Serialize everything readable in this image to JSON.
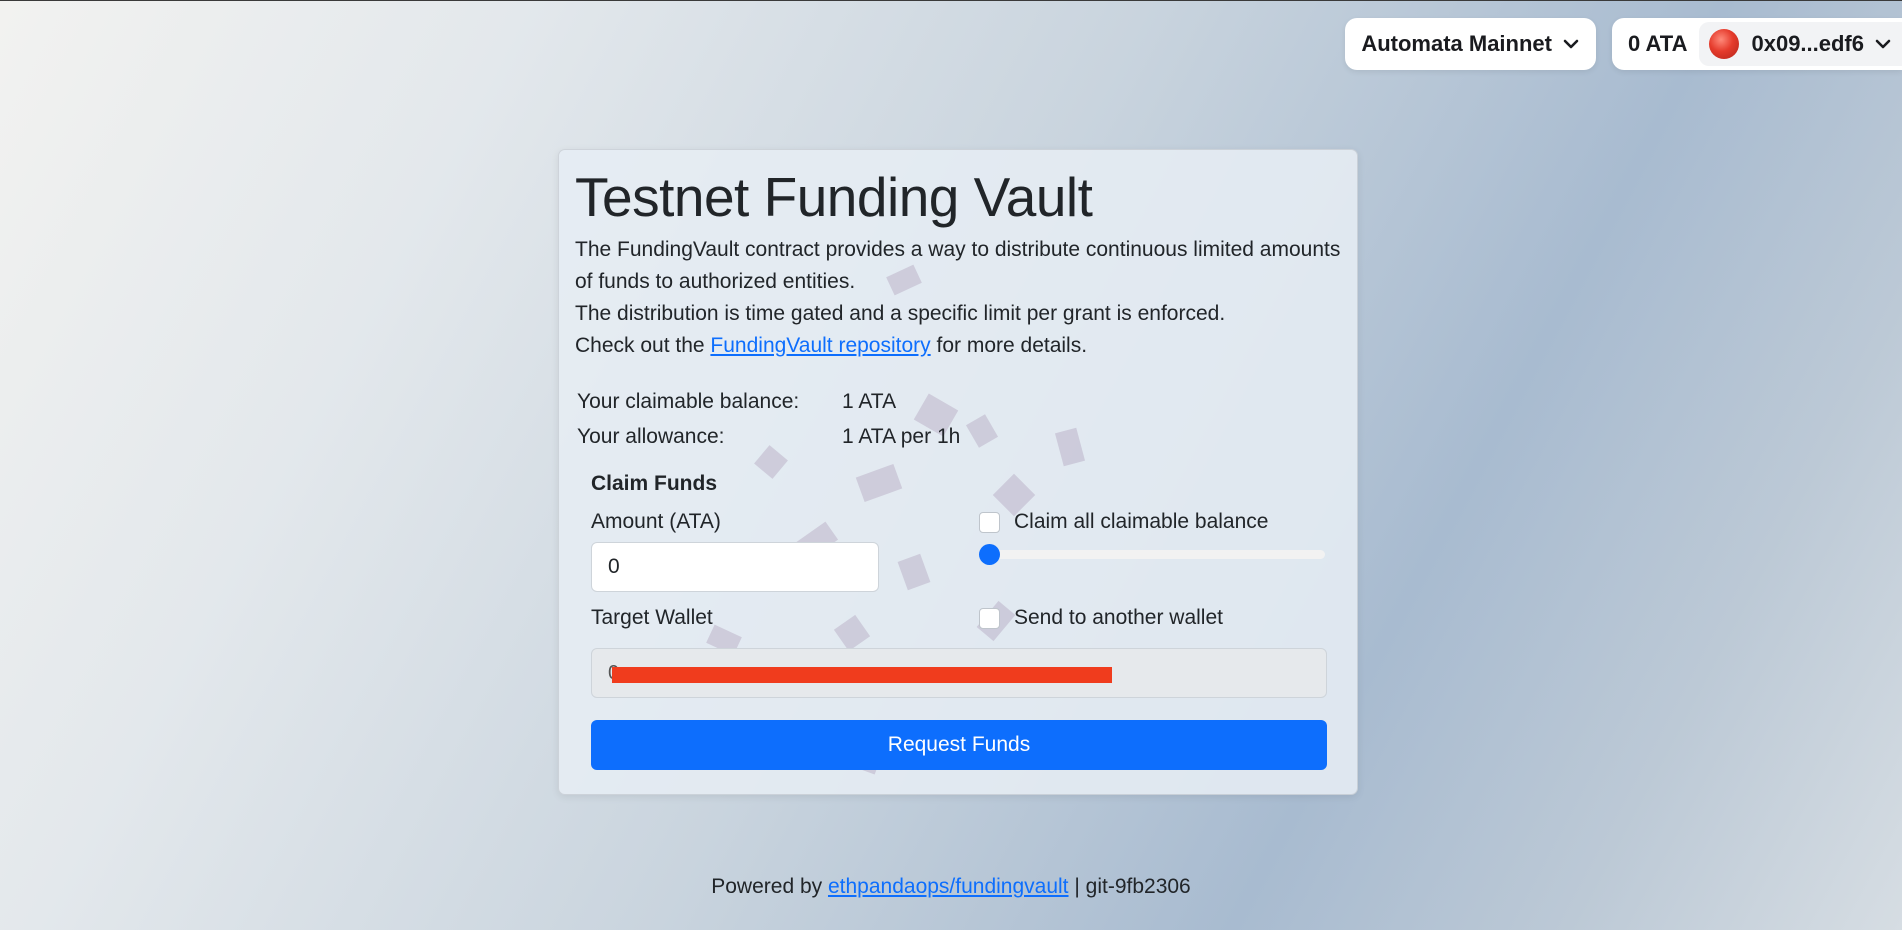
{
  "header": {
    "network_label": "Automata Mainnet",
    "balance_label": "0 ATA",
    "account_label": "0x09...edf6"
  },
  "card": {
    "title": "Testnet Funding Vault",
    "desc_line1": "The FundingVault contract provides a way to distribute continuous limited amounts of funds to authorized entities.",
    "desc_line2": "The distribution is time gated and a specific limit per grant is enforced.",
    "desc_line3_prefix": "Check out the ",
    "desc_link": "FundingVault repository",
    "desc_line3_suffix": " for more details.",
    "claimable_label": "Your claimable balance:",
    "claimable_value": "1 ATA",
    "allowance_label": "Your allowance:",
    "allowance_value": "1 ATA per 1h"
  },
  "claim": {
    "title": "Claim Funds",
    "amount_label": "Amount (ATA)",
    "amount_value": "0",
    "claim_all_label": "Claim all claimable balance",
    "slider_value": 0,
    "target_label": "Target Wallet",
    "send_other_label": "Send to another wallet",
    "wallet_value": "0",
    "button_label": "Request Funds"
  },
  "footer": {
    "prefix": "Powered by ",
    "link": "ethpandaops/fundingvault",
    "suffix": " | git-9fb2306"
  },
  "colors": {
    "accent": "#0d6efd",
    "redaction": "#f03c1d"
  }
}
